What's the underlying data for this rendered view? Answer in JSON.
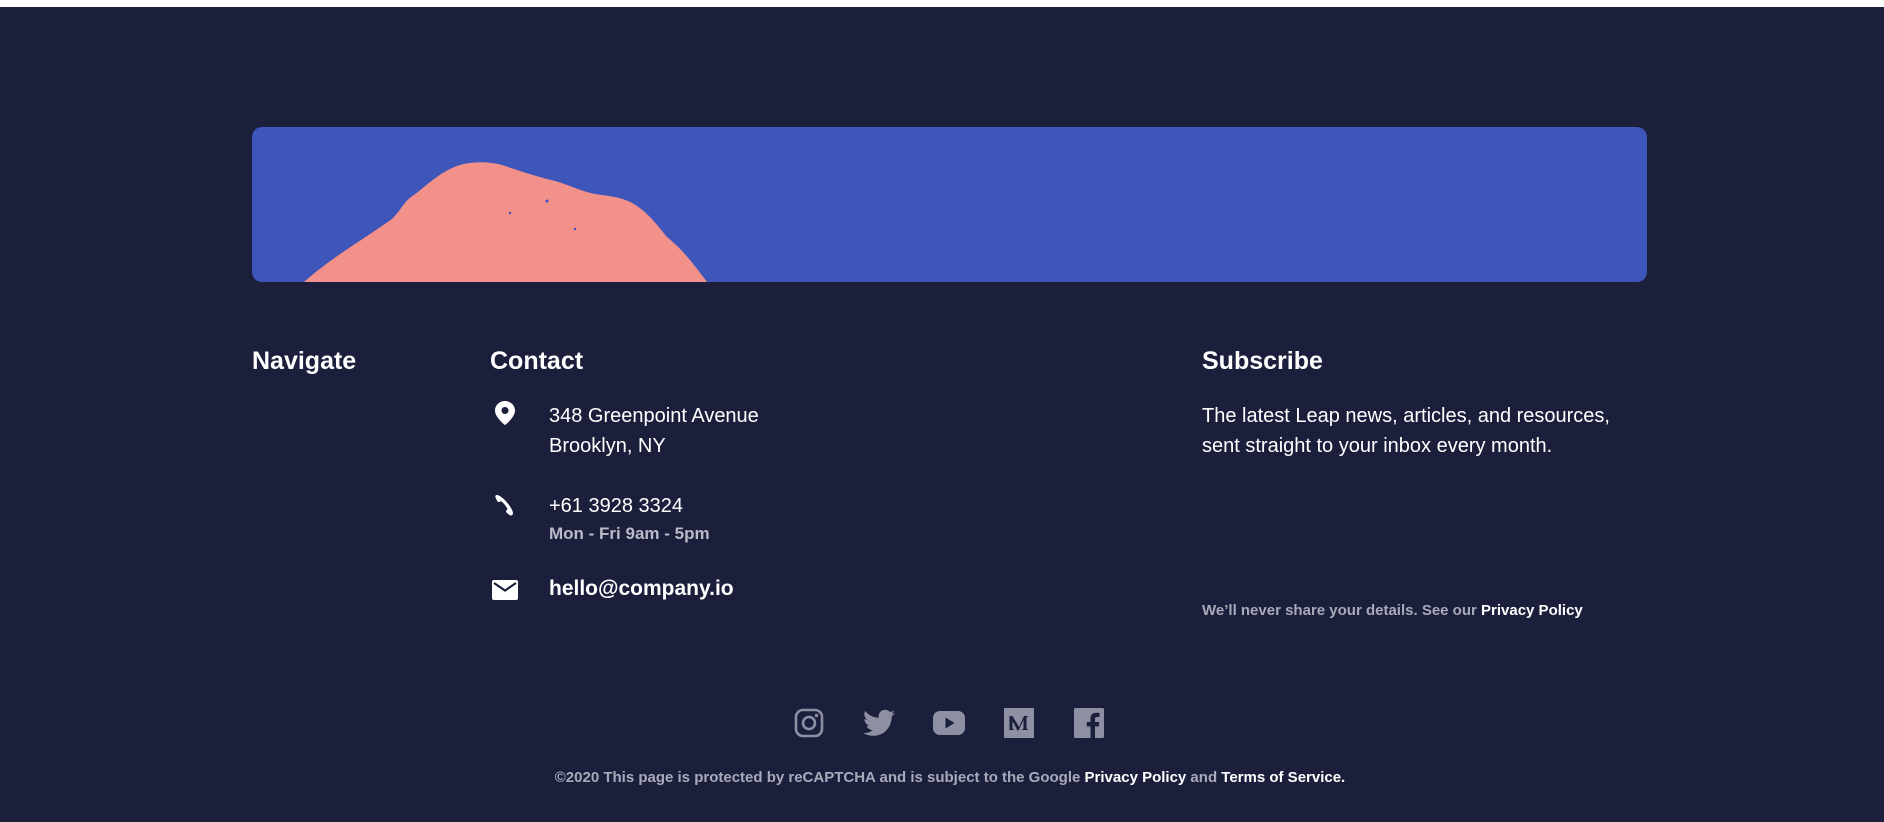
{
  "banner": {
    "background_color": "#3e55b9",
    "shape_color": "#f1918a"
  },
  "navigate": {
    "title": "Navigate"
  },
  "contact": {
    "title": "Contact",
    "address_line1": "348 Greenpoint Avenue",
    "address_line2": "Brooklyn, NY",
    "phone": "+61 3928 3324",
    "hours": "Mon - Fri 9am - 5pm",
    "email": "hello@company.io",
    "icons": [
      "location-pin-icon",
      "phone-icon",
      "mail-icon"
    ]
  },
  "subscribe": {
    "title": "Subscribe",
    "description": "The latest Leap news, articles, and resources, sent straight to your inbox every month.",
    "disclaimer_prefix": "We’ll never share your details. See our ",
    "privacy_link": "Privacy Policy"
  },
  "social": {
    "icons": [
      "instagram-icon",
      "twitter-icon",
      "youtube-icon",
      "medium-icon",
      "facebook-icon"
    ],
    "color": "#8d90a3"
  },
  "bottom": {
    "prefix": "©2020 This page is protected by reCAPTCHA and is subject to the Google ",
    "privacy_link": "Privacy Policy",
    "and": " and ",
    "terms_link": "Terms of Service."
  },
  "colors": {
    "footer_bg": "#1c1f3b",
    "muted_text": "#a7aabb"
  }
}
